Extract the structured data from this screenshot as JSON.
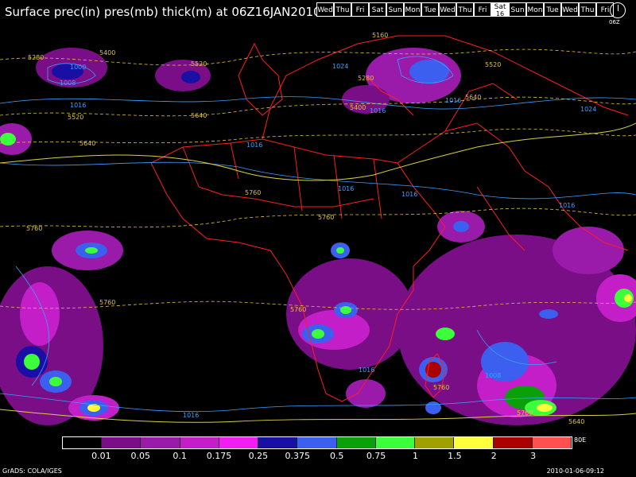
{
  "title": "Surface prec(in) pres(mb) thick(m) at 06Z16JAN2010",
  "days": [
    {
      "label": "Wed",
      "selected": false
    },
    {
      "label": "Thu",
      "selected": false
    },
    {
      "label": "Fri",
      "selected": false
    },
    {
      "label": "Sat",
      "selected": false
    },
    {
      "label": "Sun",
      "selected": false
    },
    {
      "label": "Mon",
      "selected": false
    },
    {
      "label": "Tue",
      "selected": false
    },
    {
      "label": "Wed",
      "selected": false
    },
    {
      "label": "Thu",
      "selected": false
    },
    {
      "label": "Fri",
      "selected": false
    },
    {
      "label": "Sat",
      "selected": true,
      "num": "16"
    },
    {
      "label": "Sun",
      "selected": false
    },
    {
      "label": "Mon",
      "selected": false
    },
    {
      "label": "Tue",
      "selected": false
    },
    {
      "label": "Wed",
      "selected": false
    },
    {
      "label": "Thu",
      "selected": false
    },
    {
      "label": "Fri",
      "selected": false
    }
  ],
  "clock_time": "06Z",
  "legend": {
    "colors": [
      "#000000",
      "#7a0e86",
      "#9a1aaa",
      "#c31ec8",
      "#f01ef0",
      "#1a0fa4",
      "#3c5ff0",
      "#0aa00a",
      "#3cff3c",
      "#a0a000",
      "#ffff3c",
      "#aa0000",
      "#ff5050"
    ],
    "ticks": [
      "0.01",
      "0.05",
      "0.1",
      "0.175",
      "0.25",
      "0.375",
      "0.5",
      "0.75",
      "1",
      "1.5",
      "2",
      "3"
    ],
    "edge": "80E"
  },
  "contour_labels": {
    "pressure": [
      "1000",
      "1008",
      "1016",
      "1024",
      "1016",
      "1016",
      "1016",
      "1016",
      "1016",
      "1008",
      "1016",
      "1016",
      "1024",
      "1016"
    ],
    "thickness": [
      "5280",
      "5400",
      "5520",
      "5640",
      "5760",
      "5760",
      "5760",
      "5760",
      "5760",
      "5760",
      "5520",
      "5400",
      "5280",
      "5160",
      "5640",
      "5520",
      "5640",
      "5760",
      "5640"
    ]
  },
  "credit": "GrADS: COLA/IGES",
  "timestamp": "2010-01-06-09:12"
}
